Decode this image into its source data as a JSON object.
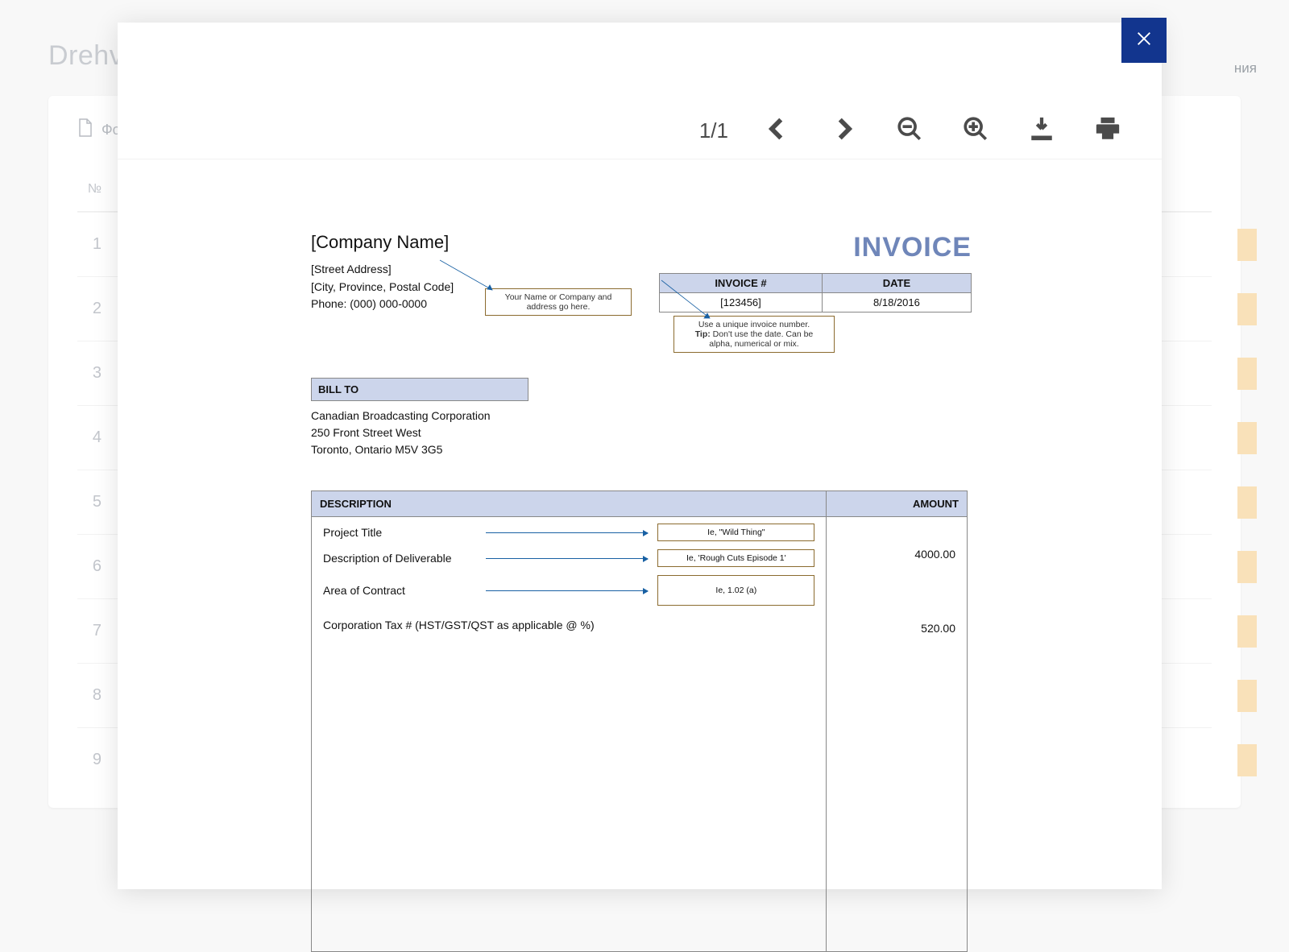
{
  "bg": {
    "brand": "Drehvo",
    "right_word": "ния",
    "sheet_label": "Фо",
    "head_num": "№",
    "rows": [
      "1",
      "2",
      "3",
      "4",
      "5",
      "6",
      "7",
      "8",
      "9"
    ]
  },
  "viewer": {
    "page_current": "1",
    "page_sep": "/",
    "page_total": "1"
  },
  "doc": {
    "company_name": "[Company Name]",
    "street": "[Street Address]",
    "city": "[City, Province, Postal Code]",
    "phone": "Phone: (000) 000-0000",
    "invoice_title": "INVOICE",
    "meta": {
      "h_invno": "INVOICE #",
      "h_date": "DATE",
      "invno": "[123456]",
      "date": "8/18/2016"
    },
    "annot_name_l1": "Your Name or Company and",
    "annot_name_l2": "address go here.",
    "annot_inv_l1": "Use a unique invoice number.",
    "annot_inv_tip": "Tip:",
    "annot_inv_l2": " Don't use the date. Can be",
    "annot_inv_l3": "alpha, numerical or mix.",
    "bill_to_hdr": "BILL TO",
    "bill_to_l1": "Canadian Broadcasting Corporation",
    "bill_to_l2": "250 Front Street West",
    "bill_to_l3": "Toronto, Ontario  M5V 3G5",
    "table": {
      "h_desc": "DESCRIPTION",
      "h_amt": "AMOUNT",
      "line1": {
        "label": "Project Title",
        "hint": "Ie, \"Wild Thing\""
      },
      "line2": {
        "label": "Description of Deliverable",
        "hint": "Ie, 'Rough Cuts Episode 1'"
      },
      "line3": {
        "label": "Area of Contract",
        "hint": "Ie, 1.02 (a)"
      },
      "tax_line": "Corporation Tax # (HST/GST/QST as applicable @ %)",
      "amt1": "4000.00",
      "amt2": "520.00"
    }
  }
}
